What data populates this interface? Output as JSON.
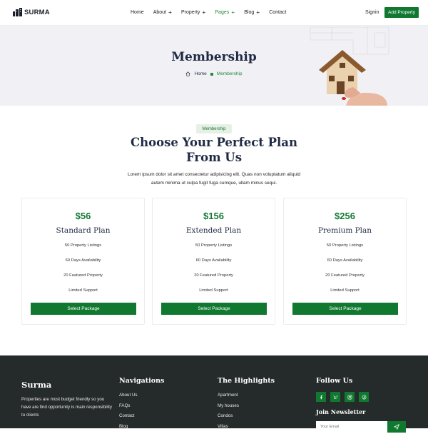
{
  "brand": {
    "name": "SURMA"
  },
  "nav": {
    "items": [
      {
        "label": "Home",
        "has_plus": false,
        "active": false
      },
      {
        "label": "About",
        "has_plus": true,
        "active": false
      },
      {
        "label": "Property",
        "has_plus": true,
        "active": false
      },
      {
        "label": "Pages",
        "has_plus": true,
        "active": true
      },
      {
        "label": "Blog",
        "has_plus": true,
        "active": false
      },
      {
        "label": "Contact",
        "has_plus": false,
        "active": false
      }
    ],
    "signin": "Signin",
    "add_property": "Add Property"
  },
  "hero": {
    "title": "Membership",
    "breadcrumb": {
      "home": "Home",
      "current": "Membership"
    }
  },
  "pricing": {
    "badge": "Membership",
    "title_line1": "Choose Your Perfect Plan",
    "title_line2": "From Us",
    "desc_line1": "Lorem ipsum dolor sit amet consectetur adipisicing elit. Quas non voluptatum aliquid",
    "desc_line2": "autem minima ut culpa fugit fuga cumque, ullam minus sequi.",
    "plans": [
      {
        "price": "$56",
        "name": "Standard Plan",
        "features": [
          "50 Property Listings",
          "60 Days Availability",
          "20 Featured Property",
          "Limited Support"
        ],
        "button": "Select Package"
      },
      {
        "price": "$156",
        "name": "Extended Plan",
        "features": [
          "50 Property Listings",
          "60 Days Availability",
          "20 Featured Property",
          "Limited Support"
        ],
        "button": "Select Package"
      },
      {
        "price": "$256",
        "name": "Premium Plan",
        "features": [
          "50 Property Listings",
          "60 Days Availability",
          "20 Featured Property",
          "Limited Support"
        ],
        "button": "Select Package"
      }
    ]
  },
  "footer": {
    "brand": "Surma",
    "desc": "Properties are most budget friendly so you have are find opportunity is main responsibility to clients",
    "navigations": {
      "title": "Navigations",
      "links": [
        "About Us",
        "FAQs",
        "Contact",
        "Blog"
      ]
    },
    "highlights": {
      "title": "The Highlights",
      "links": [
        "Apartment",
        "My houses",
        "Condos",
        "Villas"
      ]
    },
    "follow": {
      "title": "Follow Us",
      "icons": [
        "facebook-icon",
        "twitter-icon",
        "instagram-icon",
        "pinterest-icon"
      ]
    },
    "newsletter": {
      "title": "Join Newsletter",
      "placeholder": "Your Email"
    }
  },
  "colors": {
    "accent": "#10792f",
    "heading": "#1f2a44",
    "hero_bg": "#f1f0f5",
    "footer_bg": "#252b2a"
  }
}
